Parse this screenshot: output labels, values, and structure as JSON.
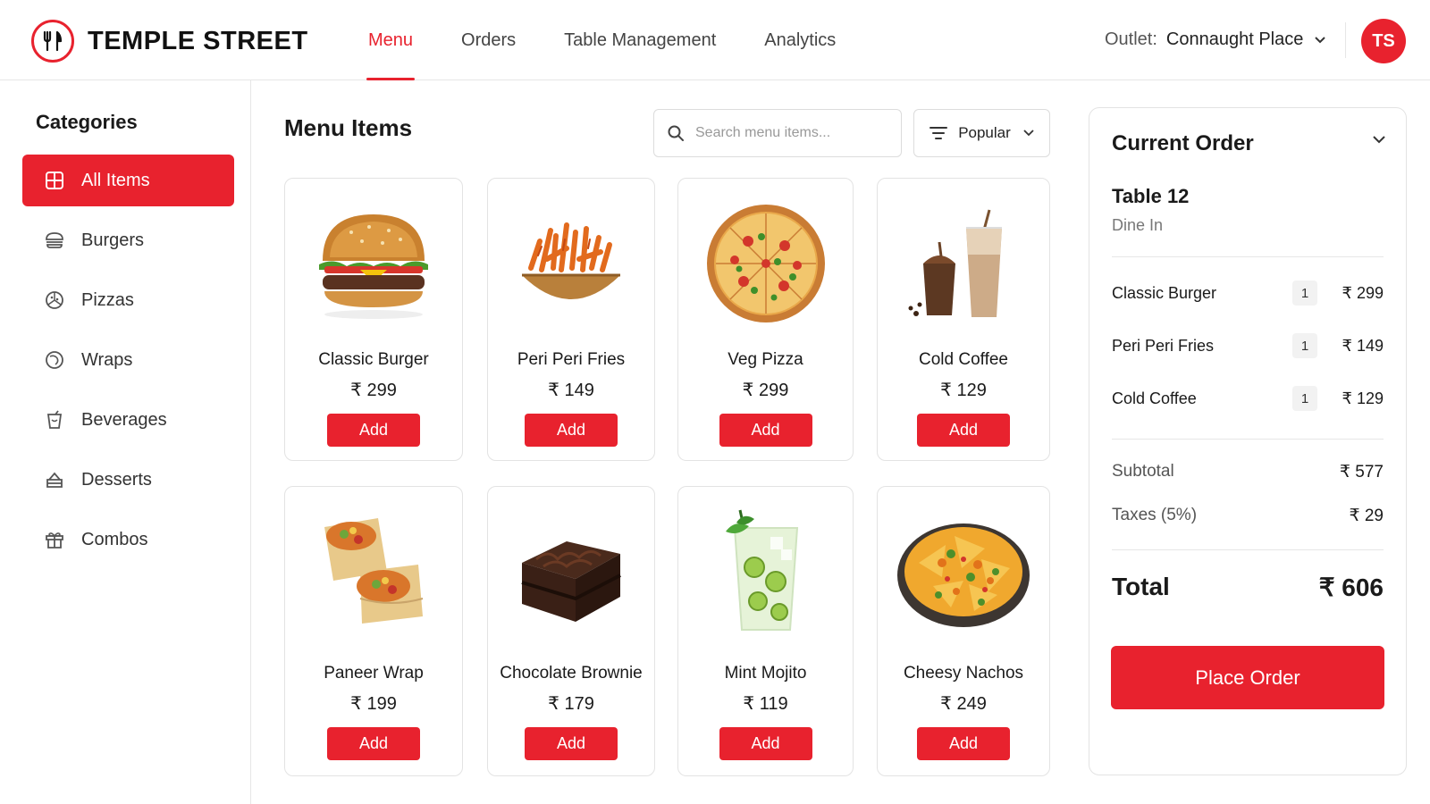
{
  "app": {
    "brand": "TEMPLE STREET",
    "accent": "#e8222e"
  },
  "nav": {
    "items": [
      {
        "label": "Menu",
        "active": true
      },
      {
        "label": "Orders"
      },
      {
        "label": "Table Management"
      },
      {
        "label": "Analytics"
      }
    ]
  },
  "outlet": {
    "label": "Outlet:",
    "value": "Connaught Place"
  },
  "user": {
    "initials": "TS"
  },
  "sidebar": {
    "title": "Categories",
    "items": [
      {
        "label": "All Items",
        "icon": "grid-icon",
        "active": true
      },
      {
        "label": "Burgers",
        "icon": "burger-icon"
      },
      {
        "label": "Pizzas",
        "icon": "pizza-icon"
      },
      {
        "label": "Wraps",
        "icon": "wrap-icon"
      },
      {
        "label": "Beverages",
        "icon": "beverage-icon"
      },
      {
        "label": "Desserts",
        "icon": "cake-icon"
      },
      {
        "label": "Combos",
        "icon": "gift-icon"
      }
    ]
  },
  "main": {
    "title": "Menu Items",
    "search_placeholder": "Search menu items...",
    "sort": {
      "label": "Popular",
      "icon": "filter-icon"
    },
    "add_label": "Add",
    "items": [
      {
        "name": "Classic Burger",
        "price": "₹ 299",
        "image": "burger"
      },
      {
        "name": "Peri Peri Fries",
        "price": "₹ 149",
        "image": "fries"
      },
      {
        "name": "Veg Pizza",
        "price": "₹ 299",
        "image": "pizza"
      },
      {
        "name": "Cold Coffee",
        "price": "₹ 129",
        "image": "coffee"
      },
      {
        "name": "Paneer Wrap",
        "price": "₹ 199",
        "image": "wrap"
      },
      {
        "name": "Chocolate Brownie",
        "price": "₹ 179",
        "image": "brownie"
      },
      {
        "name": "Mint Mojito",
        "price": "₹ 119",
        "image": "mojito"
      },
      {
        "name": "Cheesy Nachos",
        "price": "₹ 249",
        "image": "nachos"
      }
    ]
  },
  "order": {
    "title": "Current Order",
    "table": "Table 12",
    "mode": "Dine In",
    "items": [
      {
        "name": "Classic Burger",
        "qty": "1",
        "price": "₹ 299"
      },
      {
        "name": "Peri Peri Fries",
        "qty": "1",
        "price": "₹ 149"
      },
      {
        "name": "Cold Coffee",
        "qty": "1",
        "price": "₹ 129"
      }
    ],
    "subtotal_label": "Subtotal",
    "subtotal": "₹ 577",
    "tax_label": "Taxes (5%)",
    "tax": "₹ 29",
    "total_label": "Total",
    "total": "₹ 606",
    "place_label": "Place Order"
  }
}
